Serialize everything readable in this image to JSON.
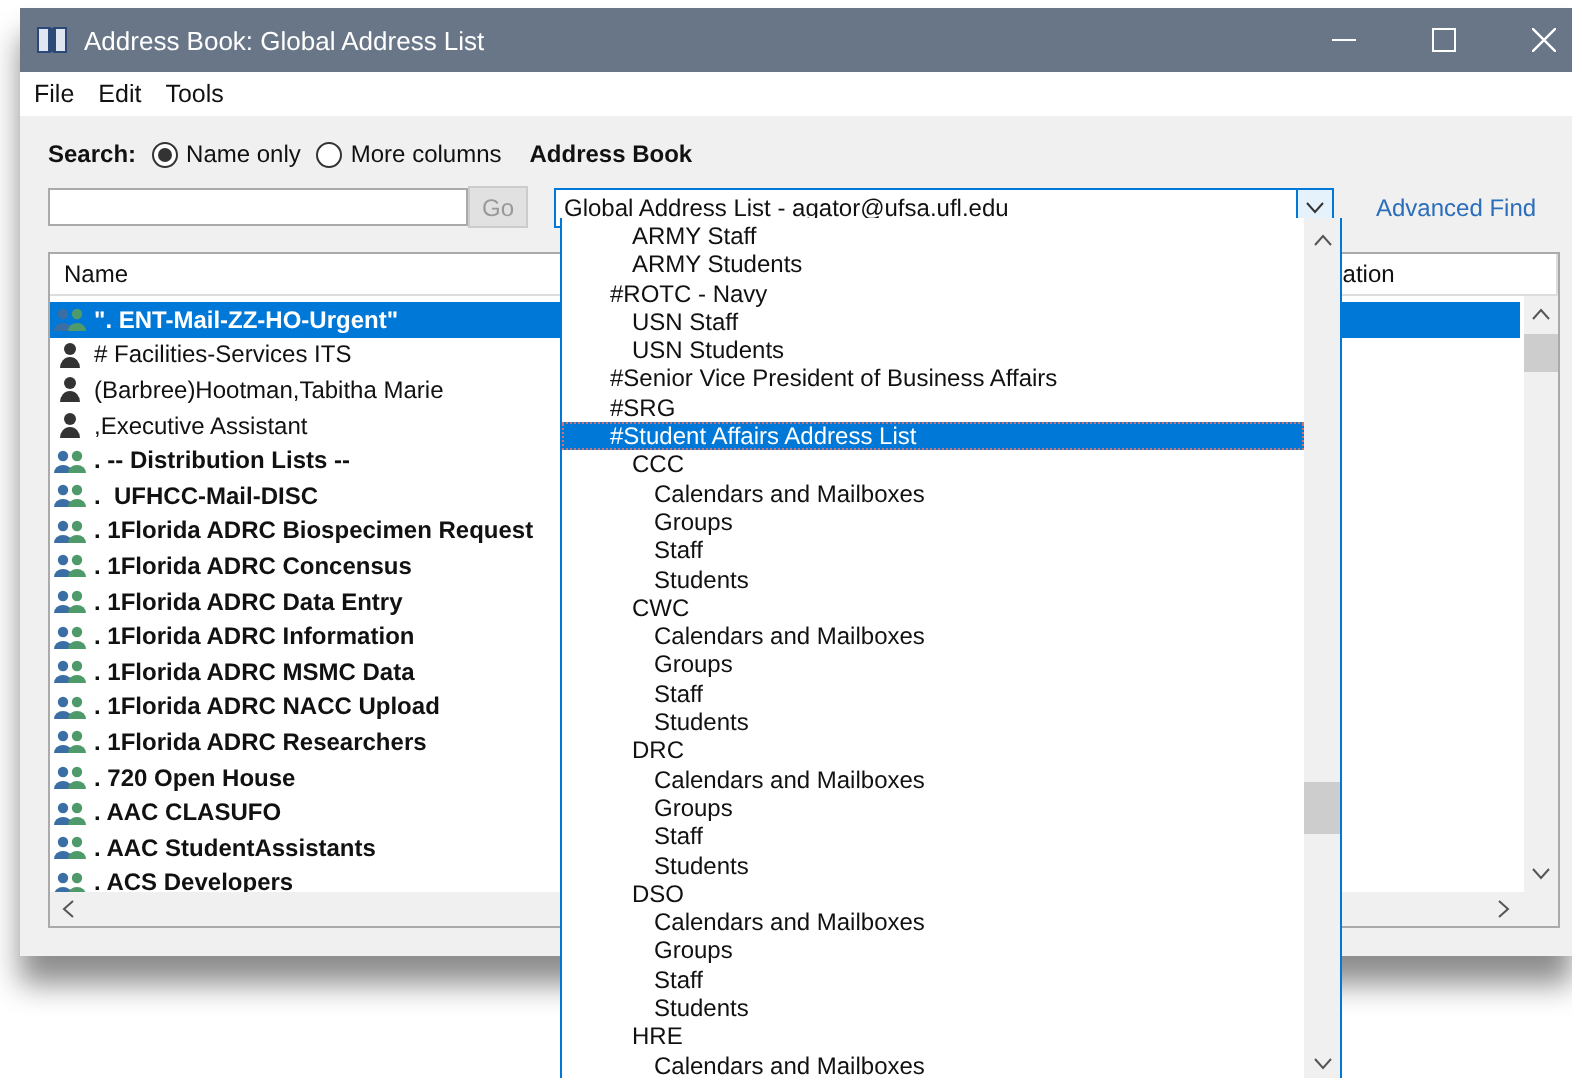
{
  "window": {
    "title": "Address Book: Global Address List"
  },
  "menu": [
    "File",
    "Edit",
    "Tools"
  ],
  "search": {
    "label": "Search:",
    "options": [
      {
        "label": "Name only",
        "selected": true
      },
      {
        "label": "More columns",
        "selected": false
      }
    ],
    "go": "Go"
  },
  "address_book": {
    "label": "Address Book",
    "value": "Global Address List - agator@ufsa.ufl.edu",
    "advanced_find": "Advanced Find"
  },
  "table": {
    "columns": [
      "Name",
      "ation"
    ],
    "rows": [
      {
        "name": "\". ENT-Mail-ZZ-HO-Urgent\"",
        "kind": "group",
        "selected": true
      },
      {
        "name": "# Facilities-Services ITS",
        "kind": "user",
        "selected": false
      },
      {
        "name": "(Barbree)Hootman,Tabitha Marie",
        "kind": "user",
        "selected": false
      },
      {
        "name": ",Executive Assistant",
        "kind": "user",
        "selected": false
      },
      {
        "name": ". -- Distribution Lists --",
        "kind": "group",
        "selected": false
      },
      {
        "name": ".  UFHCC-Mail-DISC",
        "kind": "group",
        "selected": false
      },
      {
        "name": ". 1Florida ADRC Biospecimen Request",
        "kind": "group",
        "selected": false
      },
      {
        "name": ". 1Florida ADRC Concensus",
        "kind": "group",
        "selected": false
      },
      {
        "name": ". 1Florida ADRC Data Entry",
        "kind": "group",
        "selected": false
      },
      {
        "name": ". 1Florida ADRC Information",
        "kind": "group",
        "selected": false
      },
      {
        "name": ". 1Florida ADRC MSMC Data",
        "kind": "group",
        "selected": false
      },
      {
        "name": ". 1Florida ADRC NACC Upload",
        "kind": "group",
        "selected": false
      },
      {
        "name": ". 1Florida ADRC Researchers",
        "kind": "group",
        "selected": false
      },
      {
        "name": ". 720 Open House",
        "kind": "group",
        "selected": false
      },
      {
        "name": ". AAC CLASUFO",
        "kind": "group",
        "selected": false
      },
      {
        "name": ". AAC StudentAssistants",
        "kind": "group",
        "selected": false
      },
      {
        "name": ". ACS Developers",
        "kind": "group",
        "selected": false
      }
    ]
  },
  "dropdown": {
    "items": [
      {
        "children": [
          {
            "label": "ARMY Staff",
            "selected": false
          },
          {
            "label": "ARMY Students",
            "selected": false
          }
        ]
      },
      {
        "label": "#ROTC - Navy",
        "selected": false,
        "children": [
          {
            "label": "USN Staff",
            "selected": false
          },
          {
            "label": "USN Students",
            "selected": false
          }
        ]
      },
      {
        "label": "#Senior Vice President of Business Affairs",
        "selected": false
      },
      {
        "label": "#SRG",
        "selected": false
      },
      {
        "label": "#Student Affairs Address List",
        "selected": true,
        "children": [
          {
            "label": "CCC",
            "selected": false,
            "children": [
              {
                "label": "Calendars and Mailboxes",
                "selected": false
              },
              {
                "label": "Groups",
                "selected": false
              },
              {
                "label": "Staff",
                "selected": false
              },
              {
                "label": "Students",
                "selected": false
              }
            ]
          },
          {
            "label": "CWC",
            "selected": false,
            "children": [
              {
                "label": "Calendars and Mailboxes",
                "selected": false
              },
              {
                "label": "Groups",
                "selected": false
              },
              {
                "label": "Staff",
                "selected": false
              },
              {
                "label": "Students",
                "selected": false
              }
            ]
          },
          {
            "label": "DRC",
            "selected": false,
            "children": [
              {
                "label": "Calendars and Mailboxes",
                "selected": false
              },
              {
                "label": "Groups",
                "selected": false
              },
              {
                "label": "Staff",
                "selected": false
              },
              {
                "label": "Students",
                "selected": false
              }
            ]
          },
          {
            "label": "DSO",
            "selected": false,
            "children": [
              {
                "label": "Calendars and Mailboxes",
                "selected": false
              },
              {
                "label": "Groups",
                "selected": false
              },
              {
                "label": "Staff",
                "selected": false
              },
              {
                "label": "Students",
                "selected": false
              }
            ]
          },
          {
            "label": "HRE",
            "selected": false,
            "children": [
              {
                "label": "Calendars and Mailboxes",
                "selected": false
              }
            ]
          }
        ]
      }
    ]
  }
}
